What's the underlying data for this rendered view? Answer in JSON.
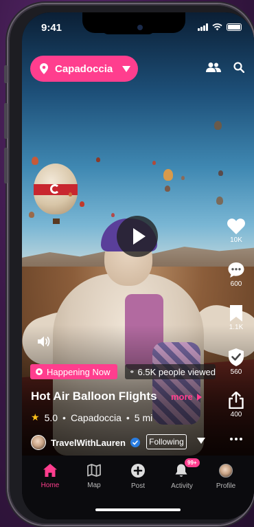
{
  "status_bar": {
    "time": "9:41"
  },
  "header": {
    "location": "Capadoccia"
  },
  "event": {
    "live_badge": "Happening Now",
    "views": "6.5K people viewed",
    "title": "Hot Air Balloon Flights",
    "more_label": "more",
    "rating": "5.0",
    "place": "Capadoccia",
    "distance": "5 mi",
    "separator": "•"
  },
  "creator": {
    "name": "TravelWithLauren",
    "follow_label": "Following"
  },
  "rail": {
    "likes": "10K",
    "comments": "600",
    "saves": "1.1K",
    "checkins": "560",
    "shares": "400"
  },
  "tabs": [
    {
      "label": "Home",
      "icon": "home-icon"
    },
    {
      "label": "Map",
      "icon": "map-icon"
    },
    {
      "label": "Post",
      "icon": "plus-circle-icon"
    },
    {
      "label": "Activity",
      "icon": "bell-icon",
      "badge": "99+"
    },
    {
      "label": "Profile",
      "icon": "avatar"
    }
  ],
  "colors": {
    "accent": "#ff3e8e",
    "tabbar": "#0b0b0e",
    "verified": "#2a7de1",
    "star": "#ffc21a"
  }
}
